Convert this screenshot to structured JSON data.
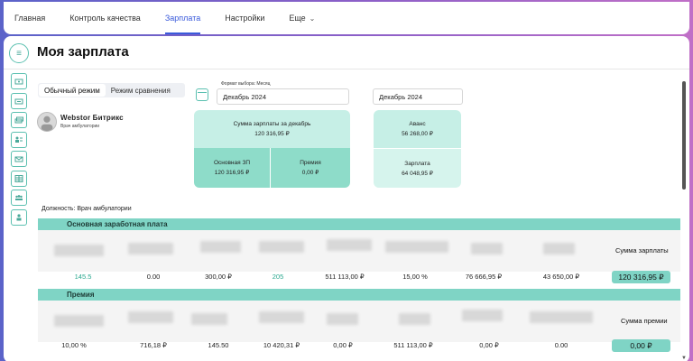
{
  "nav": {
    "items": [
      "Главная",
      "Контроль качества",
      "Зарплата",
      "Настройки",
      "Еще"
    ],
    "active": "Зарплата"
  },
  "page": {
    "title": "Моя зарплата"
  },
  "modes": {
    "normal": "Обычный режим",
    "compare": "Режим сравнения"
  },
  "profile": {
    "name": "Webstor Битрикс",
    "role": "Врач амбулатории"
  },
  "period": {
    "format_label": "Формат выбора: Месяц",
    "selected": "Декабрь 2024",
    "selected_right": "Декабрь 2024"
  },
  "summary": {
    "total_label": "Сумма зарплаты за декабрь",
    "total_value": "120 316,95 ₽",
    "base_label": "Основная ЗП",
    "base_value": "120 316,95 ₽",
    "bonus_label": "Премия",
    "bonus_value": "0,00 ₽",
    "advance_label": "Аванс",
    "advance_value": "56 268,00 ₽",
    "salary_label": "Зарплата",
    "salary_value": "64 048,95 ₽"
  },
  "position": "Должность: Врач амбулатории",
  "base_section": {
    "title": "Основная заработная плата",
    "sum_header": "Сумма зарплаты",
    "values": [
      "145.5",
      "0.00",
      "300,00 ₽",
      "205",
      "511 113,00 ₽",
      "15,00 %",
      "76 666,95 ₽",
      "43 650,00 ₽"
    ],
    "total": "120 316,95 ₽"
  },
  "bonus_section": {
    "title": "Премия",
    "sum_header": "Сумма премии",
    "values": [
      "10,00 %",
      "716,18 ₽",
      "145.50",
      "10 420,31 ₽",
      "0,00 ₽",
      "511 113,00 ₽",
      "0,00 ₽",
      "0.00"
    ],
    "total": "0,00 ₽"
  }
}
